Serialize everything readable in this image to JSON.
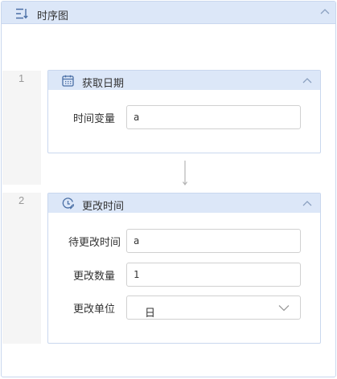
{
  "panel": {
    "title": "时序图"
  },
  "steps": [
    {
      "number": "1",
      "title": "获取日期",
      "fields": [
        {
          "label": "时间变量",
          "value": "a"
        }
      ]
    },
    {
      "number": "2",
      "title": "更改时间",
      "fields": [
        {
          "label": "待更改时间",
          "value": "a"
        },
        {
          "label": "更改数量",
          "value": "1"
        },
        {
          "label": "更改单位",
          "value": "日"
        }
      ]
    }
  ],
  "icons": {
    "panel": "sequence-diagram-icon",
    "step1": "calendar-icon",
    "step2": "clock-edit-icon",
    "collapse": "chevron-up-icon",
    "select": "chevron-down-icon",
    "connector": "arrow-down-icon"
  },
  "colors": {
    "header_bg": "#dce7f8",
    "border": "#c9d7ee",
    "gutter_bg": "#f5f5f5",
    "icon": "#4a6fa5"
  }
}
